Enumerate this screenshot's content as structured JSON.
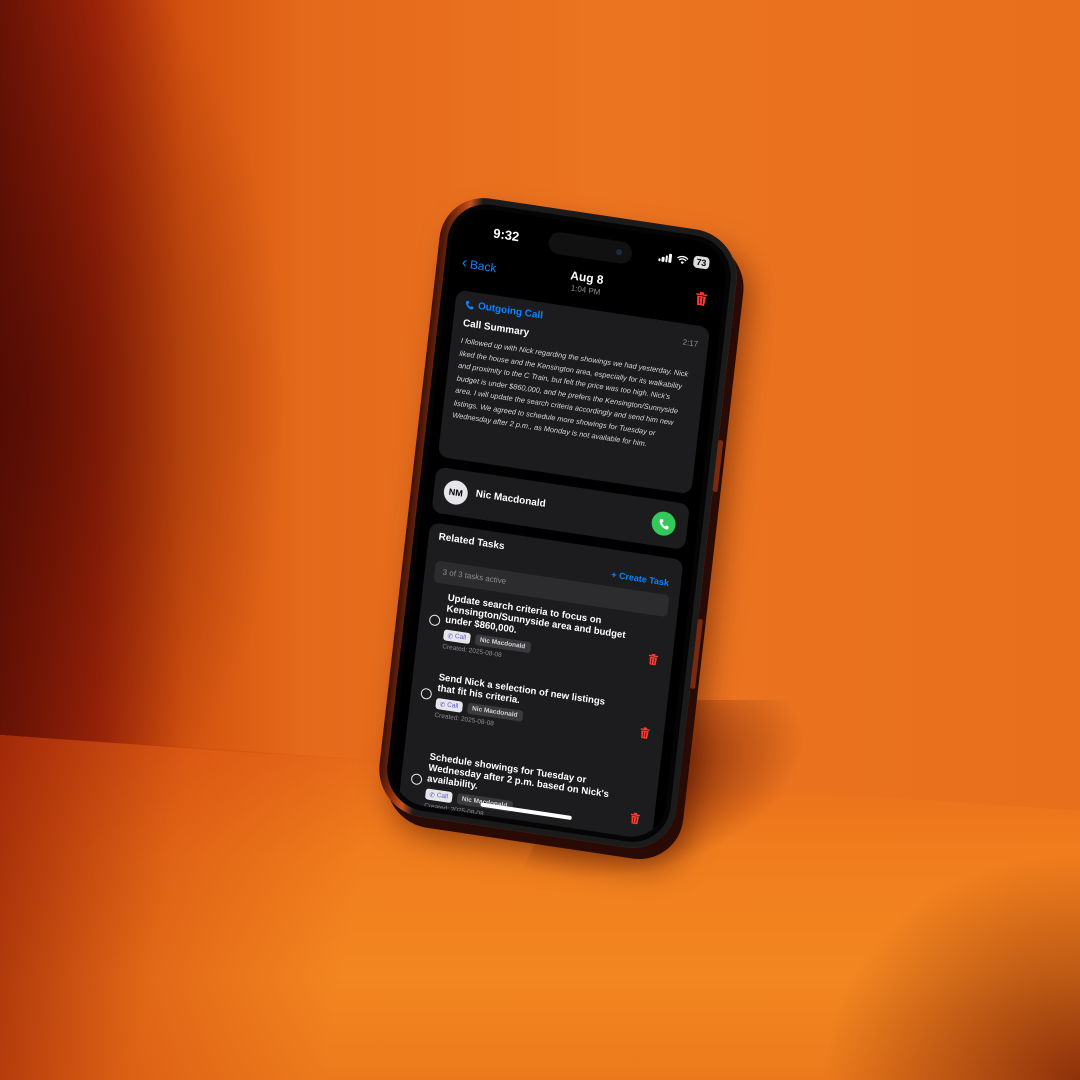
{
  "colors": {
    "accent": "#0a84ff",
    "destructive": "#ff3b30",
    "call_green": "#34c759",
    "card_bg": "#1c1c1e"
  },
  "status_bar": {
    "time": "9:32",
    "battery": "73"
  },
  "nav": {
    "back_label": "Back",
    "title": "Aug 8",
    "subtitle": "1:04 PM",
    "trash_icon": "trash-icon"
  },
  "summary": {
    "call_type": "Outgoing Call",
    "duration": "2:17",
    "heading": "Call Summary",
    "text": "I followed up with Nick regarding the showings we had yesterday. Nick liked the house and the Kensington area, especially for its walkability and proximity to the C Train, but felt the price was too high. Nick's budget is under $860,000, and he prefers the Kensington/Sunnyside area. I will update the search criteria accordingly and send him new listings. We agreed to schedule more showings for Tuesday or Wednesday after 2 p.m., as Monday is not available for him."
  },
  "contact": {
    "initials": "NM",
    "name": "Nic Macdonald"
  },
  "tasks": {
    "heading": "Related Tasks",
    "create_label": "Create Task",
    "count_text": "3 of 3 tasks active",
    "items": [
      {
        "title": "Update search criteria to focus on Kensington/Sunnyside area and budget under $860,000.",
        "tag_call": "Call",
        "tag_contact": "Nic Macdonald",
        "created": "Created: 2025-08-08"
      },
      {
        "title": "Send Nick a selection of new listings that fit his criteria.",
        "tag_call": "Call",
        "tag_contact": "Nic Macdonald",
        "created": "Created: 2025-08-08"
      },
      {
        "title": "Schedule showings for Tuesday or Wednesday after 2 p.m. based on Nick's availability.",
        "tag_call": "Call",
        "tag_contact": "Nic Macdonald",
        "created": "Created: 2025-08-08"
      }
    ]
  }
}
